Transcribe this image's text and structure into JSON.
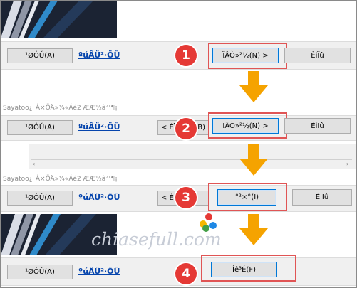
{
  "frames": [
    {
      "back_label": "¹ØÓÚ(A)",
      "link_label": "ºúÂÜ²·ÖÜ",
      "next_label": "ÏÂÒ»²½(N) >",
      "cancel_label": "ÈiÏû",
      "step": "1"
    },
    {
      "installer_text": "Sayatoo¿¨À­×ÖÄ»¾«Áé2 ÆÆ½â²¹¶¡",
      "back_label": "¹ØÓÚ(A)",
      "link_label": "ºúÂÜ²·ÖÜ",
      "prev_label": "< ÉÏ",
      "prev_suffix": "B)",
      "next_label": "ÏÂÒ»²½(N) >",
      "cancel_label": "ÈiÏû",
      "step": "2"
    },
    {
      "installer_text": "Sayatoo¿¨À­×ÖÄ»¾«Áé2 ÆÆ½â²¹¶¡",
      "back_label": "¹ØÓÚ(A)",
      "link_label": "ºúÂÜ²·ÖÜ",
      "prev_label": "< É",
      "install_label": "°²×°(I)",
      "cancel_label": "ÈiÏû",
      "step": "3"
    },
    {
      "back_label": "¹ØÓÚ(A)",
      "link_label": "ºúÂÜ²·ÖÜ",
      "finish_label": "Íê³É(F)",
      "step": "4"
    }
  ],
  "scroll": {
    "left_arrow": "‹",
    "right_arrow": "›"
  },
  "watermark": {
    "text": "chiasefull.com"
  },
  "colors": {
    "badge": "#e53935",
    "arrow": "#f5a300",
    "highlight_box": "#e05555",
    "link": "#0645ad",
    "primary_border": "#0078d7"
  },
  "icons": {
    "flow_arrow": "down-arrow-icon",
    "step_badge": "numbered-circle"
  }
}
